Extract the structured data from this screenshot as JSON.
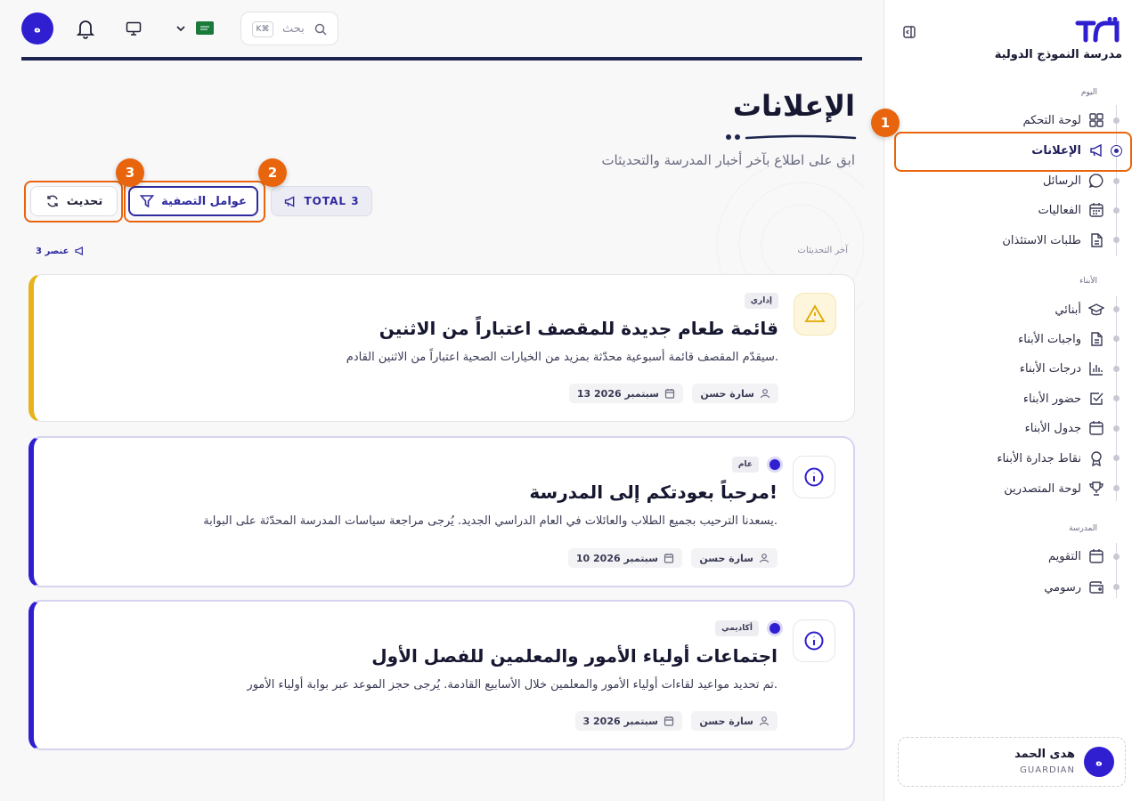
{
  "app": {
    "school_name": "مدرسة النموذج الدولية",
    "accent": "#2f1fd1",
    "highlight": "#e8650e"
  },
  "sidebar": {
    "sections": [
      {
        "label": "اليوم",
        "items": [
          {
            "label": "لوحة التحكم",
            "icon": "dashboard-icon"
          },
          {
            "label": "الإعلانات",
            "icon": "megaphone-icon",
            "active": true
          },
          {
            "label": "الرسائل",
            "icon": "chat-icon"
          },
          {
            "label": "الفعاليات",
            "icon": "calendar-grid-icon"
          },
          {
            "label": "طلبات الاستئذان",
            "icon": "document-icon"
          }
        ]
      },
      {
        "label": "الأبناء",
        "items": [
          {
            "label": "أبنائي",
            "icon": "graduation-cap-icon"
          },
          {
            "label": "واجبات الأبناء",
            "icon": "document-icon"
          },
          {
            "label": "درجات الأبناء",
            "icon": "bar-chart-icon"
          },
          {
            "label": "حضور الأبناء",
            "icon": "check-square-icon"
          },
          {
            "label": "جدول الأبناء",
            "icon": "calendar-icon"
          },
          {
            "label": "نقاط جدارة الأبناء",
            "icon": "award-icon"
          },
          {
            "label": "لوحة المتصدرين",
            "icon": "trophy-icon"
          }
        ]
      },
      {
        "label": "المدرسة",
        "items": [
          {
            "label": "التقويم",
            "icon": "calendar-icon"
          },
          {
            "label": "رسومي",
            "icon": "wallet-icon"
          }
        ]
      }
    ],
    "user": {
      "name": "هدى الحمد",
      "role": "GUARDIAN",
      "initial": "ه"
    }
  },
  "topbar": {
    "search_placeholder": "بحث",
    "shortcut": "K⌘",
    "avatar_initial": "ه"
  },
  "page": {
    "title": "الإعلانات",
    "subtitle": "ابق على اطلاع بآخر أخبار المدرسة والتحديثات",
    "total_label": "TOTAL 3",
    "filters_label": "عوامل التصفية",
    "refresh_label": "تحديث",
    "latest_label": "آخر التحديثات",
    "count_label": "3 عنصر"
  },
  "markers": [
    "1",
    "2",
    "3"
  ],
  "announcements": [
    {
      "category": "إداري",
      "title": "قائمة طعام جديدة للمقصف اعتباراً من الاثنين",
      "body": "سيقدّم المقصف قائمة أسبوعية محدّثة بمزيد من الخيارات الصحية اعتباراً من الاثنين القادم.",
      "author": "سارة حسن",
      "date": "13 سبتمبر 2026",
      "kind": "warning",
      "accent": "#e8b21a",
      "unread": false
    },
    {
      "category": "عام",
      "title": "مرحباً بعودتكم إلى المدرسة!",
      "body": "يسعدنا الترحيب بجميع الطلاب والعائلات في العام الدراسي الجديد. يُرجى مراجعة سياسات المدرسة المحدّثة على البوابة.",
      "author": "سارة حسن",
      "date": "10 سبتمبر 2026",
      "kind": "info",
      "accent": "#2f1fd1",
      "unread": true
    },
    {
      "category": "أكاديمي",
      "title": "اجتماعات أولياء الأمور والمعلمين للفصل الأول",
      "body": "تم تحديد مواعيد لقاءات أولياء الأمور والمعلمين خلال الأسابيع القادمة. يُرجى حجز الموعد عبر بوابة أولياء الأمور.",
      "author": "سارة حسن",
      "date": "3 سبتمبر 2026",
      "kind": "info",
      "accent": "#2f1fd1",
      "unread": true
    }
  ]
}
